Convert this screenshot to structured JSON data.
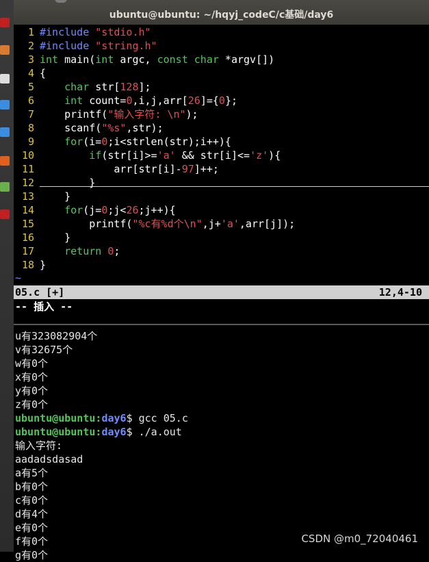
{
  "window": {
    "title": "ubuntu@ubuntu: ~/hqyj_codeC/c基础/day6"
  },
  "editor": {
    "lines": [
      {
        "n": "1",
        "segs": [
          [
            "pp",
            "#include "
          ],
          [
            "str",
            "\"stdio.h\""
          ]
        ]
      },
      {
        "n": "2",
        "segs": [
          [
            "pp",
            "#include "
          ],
          [
            "str",
            "\"string.h\""
          ]
        ]
      },
      {
        "n": "3",
        "segs": [
          [
            "ty",
            "int"
          ],
          [
            "def",
            " main("
          ],
          [
            "ty",
            "int"
          ],
          [
            "def",
            " argc, "
          ],
          [
            "ty",
            "const char"
          ],
          [
            "def",
            " *argv[])"
          ]
        ]
      },
      {
        "n": "4",
        "segs": [
          [
            "def",
            "{"
          ]
        ]
      },
      {
        "n": "5",
        "segs": [
          [
            "def",
            "    "
          ],
          [
            "ty",
            "char"
          ],
          [
            "def",
            " str["
          ],
          [
            "num",
            "128"
          ],
          [
            "def",
            "];"
          ]
        ]
      },
      {
        "n": "6",
        "segs": [
          [
            "def",
            "    "
          ],
          [
            "ty",
            "int"
          ],
          [
            "def",
            " count="
          ],
          [
            "num",
            "0"
          ],
          [
            "def",
            ",i,j,arr["
          ],
          [
            "num",
            "26"
          ],
          [
            "def",
            "]={"
          ],
          [
            "num",
            "0"
          ],
          [
            "def",
            "};"
          ]
        ]
      },
      {
        "n": "7",
        "segs": [
          [
            "def",
            "    printf("
          ],
          [
            "str",
            "\"输入字符: \\n\""
          ],
          [
            "def",
            ");"
          ]
        ]
      },
      {
        "n": "8",
        "segs": [
          [
            "def",
            "    scanf("
          ],
          [
            "str",
            "\"%s\""
          ],
          [
            "def",
            ",str);"
          ]
        ]
      },
      {
        "n": "9",
        "segs": [
          [
            "def",
            "    "
          ],
          [
            "kw",
            "for"
          ],
          [
            "def",
            "(i="
          ],
          [
            "num",
            "0"
          ],
          [
            "def",
            ";i<strlen(str);i++){"
          ]
        ]
      },
      {
        "n": "10",
        "segs": [
          [
            "def",
            "        "
          ],
          [
            "kw",
            "if"
          ],
          [
            "def",
            "(str[i]>="
          ],
          [
            "str",
            "'a'"
          ],
          [
            "def",
            " && str[i]<="
          ],
          [
            "str",
            "'z'"
          ],
          [
            "def",
            ")"
          ],
          [
            "def",
            "{"
          ]
        ]
      },
      {
        "n": "11",
        "segs": [
          [
            "def",
            "            arr[str[i]-"
          ],
          [
            "num",
            "97"
          ],
          [
            "def",
            "]++;"
          ]
        ]
      },
      {
        "n": "12",
        "segs": [
          [
            "def",
            "        "
          ],
          [
            "def",
            "}"
          ]
        ]
      },
      {
        "n": "13",
        "segs": [
          [
            "def",
            "    }"
          ]
        ]
      },
      {
        "n": "14",
        "segs": [
          [
            "def",
            "    "
          ],
          [
            "kw",
            "for"
          ],
          [
            "def",
            "(j="
          ],
          [
            "num",
            "0"
          ],
          [
            "def",
            ";j<"
          ],
          [
            "num",
            "26"
          ],
          [
            "def",
            ";j++){"
          ]
        ]
      },
      {
        "n": "15",
        "segs": [
          [
            "def",
            "        printf("
          ],
          [
            "str",
            "\"%c有%d个\\n\""
          ],
          [
            "def",
            ",j+"
          ],
          [
            "str",
            "'a'"
          ],
          [
            "def",
            ",arr[j]);"
          ]
        ]
      },
      {
        "n": "16",
        "segs": [
          [
            "def",
            "    }"
          ]
        ]
      },
      {
        "n": "17",
        "segs": [
          [
            "def",
            "    "
          ],
          [
            "kw",
            "return"
          ],
          [
            "def",
            " "
          ],
          [
            "num",
            "0"
          ],
          [
            "def",
            ";"
          ]
        ]
      },
      {
        "n": "18",
        "segs": [
          [
            "def",
            "}"
          ]
        ]
      }
    ],
    "tilde": "~",
    "status_file": "05.c [+]",
    "status_pos": "12,4-10",
    "mode": "-- 插入 --"
  },
  "terminal": {
    "output_before": [
      "u有323082904个",
      "v有32675个",
      "w有0个",
      "x有0个",
      "y有0个",
      "z有0个"
    ],
    "prompt_user": "ubuntu@ubuntu",
    "prompt_path": "day6",
    "cmd1": "$ gcc 05.c",
    "cmd2": "$ ./a.out",
    "output_after": [
      "输入字符:",
      "aadadsdasad",
      "a有5个",
      "b有0个",
      "c有0个",
      "d有4个",
      "e有0个",
      "f有0个",
      "g有0个"
    ]
  },
  "watermark": "CSDN @m0_72040461",
  "colors": {
    "launcher_icons": [
      "#c02020",
      "#d87a30",
      "#dddddd",
      "#3a8de0",
      "#3a8de0",
      "#e06020",
      "#6ab04c",
      "#c02020"
    ]
  }
}
